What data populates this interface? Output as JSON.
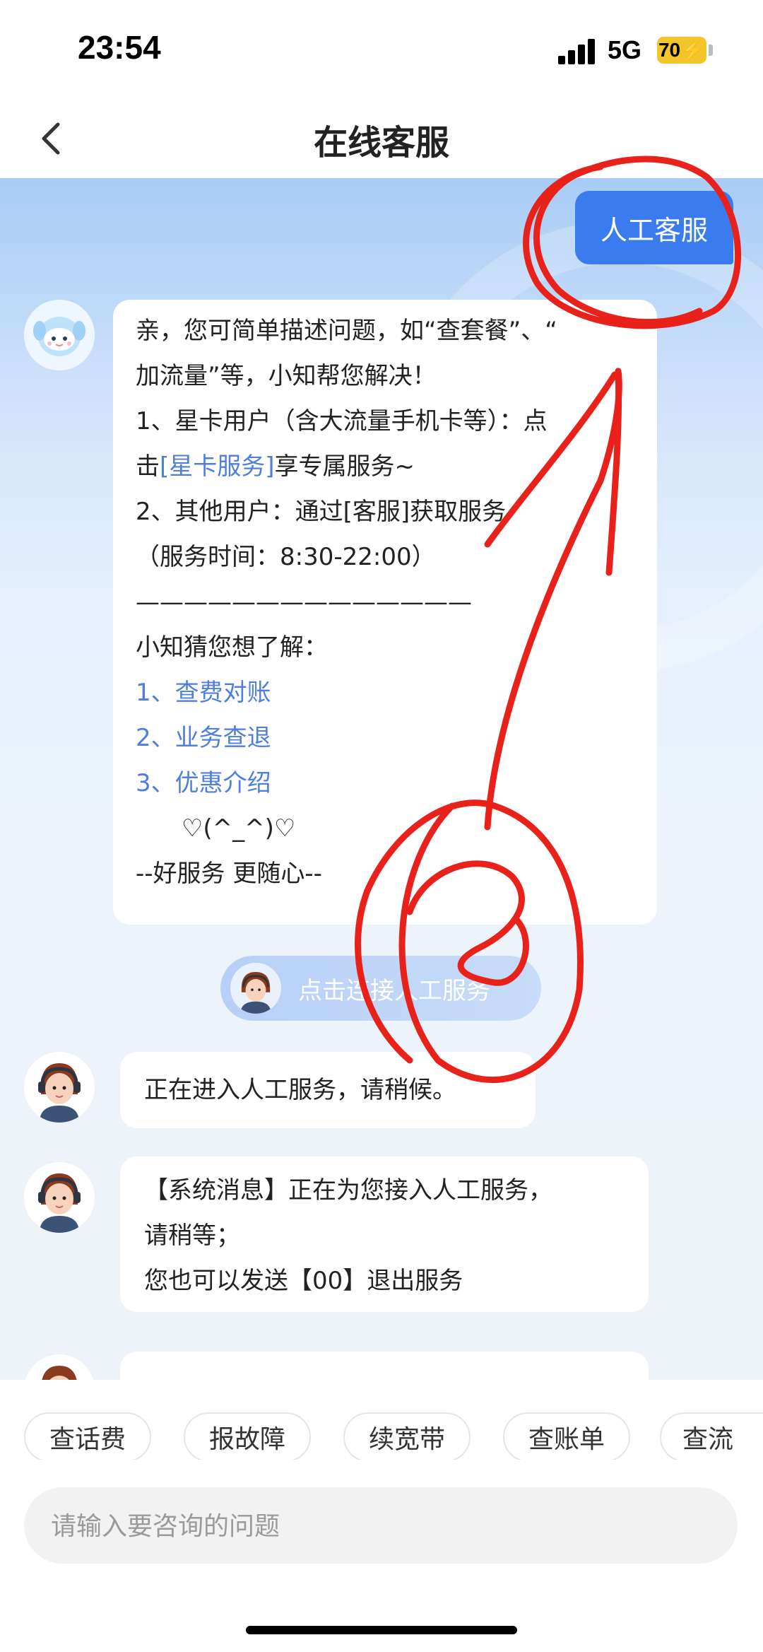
{
  "status_bar": {
    "time": "23:54",
    "network": "5G",
    "battery": "70"
  },
  "nav": {
    "title": "在线客服"
  },
  "human_service_button": "人工客服",
  "bot_message": {
    "lines": [
      "亲，您可简单描述问题，如“查套餐”、“",
      "加流量”等，小知帮您解决！",
      "1、星卡用户（含大流量手机卡等）：点",
      "2、其他用户：通过[客服]获取服务",
      "（服务时间：8:30-22:00）",
      "——————————————",
      "小知猜您想了解：",
      "      ♡(^_^)♡",
      "--好服务 更随心--"
    ],
    "star_prefix": "击",
    "star_link": "[星卡服务]",
    "star_suffix": "享专属服务~",
    "suggestions": [
      "1、查费对账",
      "2、业务查退",
      "3、优惠介绍"
    ]
  },
  "system_pill": "点击连接人工服务",
  "agent_messages": [
    {
      "lines": [
        "正在进入人工服务，请稍候。"
      ]
    },
    {
      "lines": [
        "【系统消息】正在为您接入人工服务，",
        "请稍等；",
        "您也可以发送【00】退出服务"
      ]
    }
  ],
  "quick_replies": [
    "查话费",
    "报故障",
    "续宽带",
    "查账单",
    "查流"
  ],
  "input": {
    "placeholder": "请输入要咨询的问题"
  },
  "colors": {
    "primary": "#3a7cf0",
    "link": "#4e7fdc",
    "annotation": "#e8221b"
  }
}
